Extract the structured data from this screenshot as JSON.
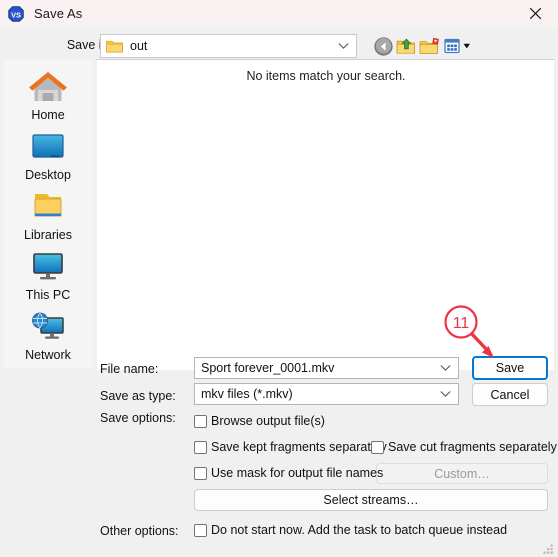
{
  "window": {
    "title": "Save As",
    "app_icon": "vs-badge-icon",
    "close_label": "✕",
    "titlebar_color": "#faf2f2",
    "body_color": "#f0f0f0"
  },
  "navigation": {
    "save_in_label": "Save in:",
    "current_folder": "out",
    "toolbar": [
      {
        "name": "back-icon",
        "tooltip": "Back"
      },
      {
        "name": "up-folder-icon",
        "tooltip": "Up One Level"
      },
      {
        "name": "new-folder-icon",
        "tooltip": "Create New Folder"
      },
      {
        "name": "views-icon",
        "tooltip": "View Menu"
      }
    ]
  },
  "places": [
    {
      "label": "Home",
      "icon": "home-icon"
    },
    {
      "label": "Desktop",
      "icon": "desktop-icon"
    },
    {
      "label": "Libraries",
      "icon": "libraries-folder-icon"
    },
    {
      "label": "This PC",
      "icon": "this-pc-monitor-icon"
    },
    {
      "label": "Network",
      "icon": "network-globe-icon"
    }
  ],
  "file_list": {
    "empty_message": "No items match your search."
  },
  "form": {
    "file_name_label": "File name:",
    "file_name_value": "Sport forever_0001.mkv",
    "save_as_type_label": "Save as type:",
    "save_as_type_value": "mkv files (*.mkv)",
    "save_options_label": "Save options:",
    "other_options_label": "Other options:",
    "checkboxes": {
      "browse_output": {
        "label": "Browse output file(s)",
        "checked": false
      },
      "save_kept": {
        "label": "Save kept fragments separately",
        "checked": false
      },
      "save_cut": {
        "label": "Save cut fragments separately",
        "checked": false
      },
      "use_mask": {
        "label": "Use mask for output file names",
        "checked": false
      },
      "batch_queue": {
        "label": "Do not start now. Add the task to batch queue instead",
        "checked": false
      }
    },
    "buttons": {
      "save": "Save",
      "cancel": "Cancel",
      "custom": "Custom…",
      "select_streams": "Select streams…"
    }
  },
  "annotation": {
    "step_number": "11",
    "color": "#ee3344",
    "points_to": "save-button"
  }
}
